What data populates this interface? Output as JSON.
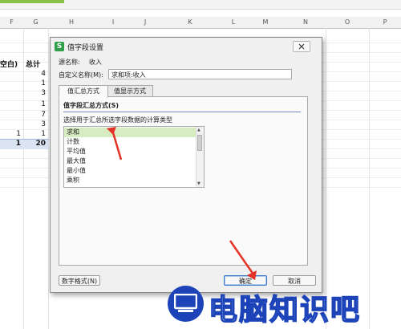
{
  "spreadsheet": {
    "columns": [
      "F",
      "G",
      "H",
      "I",
      "J",
      "K",
      "L",
      "M",
      "N",
      "O",
      "P"
    ],
    "header_cells": [
      "空白)",
      "总计"
    ],
    "g_values": [
      "4",
      "1",
      "3",
      "1",
      "7",
      "3",
      "1"
    ],
    "f_values": [
      "1"
    ],
    "total_row": {
      "f": "1",
      "g": "20"
    }
  },
  "dialog": {
    "title": "值字段设置",
    "app_icon": "S",
    "source_label": "源名称:",
    "source_value": "收入",
    "custom_name_label": "自定义名称(M):",
    "custom_name_value": "求和项:收入",
    "tabs": [
      {
        "label": "值汇总方式",
        "active": true
      },
      {
        "label": "值显示方式",
        "active": false
      }
    ],
    "group_title": "值字段汇总方式(S)",
    "list_description": "选择用于汇总所选字段数据的计算类型",
    "summary_types": [
      "求和",
      "计数",
      "平均值",
      "最大值",
      "最小值",
      "乘积"
    ],
    "selected_type": "求和",
    "number_format_button": "数字格式(N)",
    "ok_button": "确定",
    "cancel_button": "取消"
  },
  "watermark": {
    "icon": "monitor-icon",
    "text": "电脑知识吧",
    "color": "#1c44b8"
  },
  "annotation_color": "#e53226"
}
